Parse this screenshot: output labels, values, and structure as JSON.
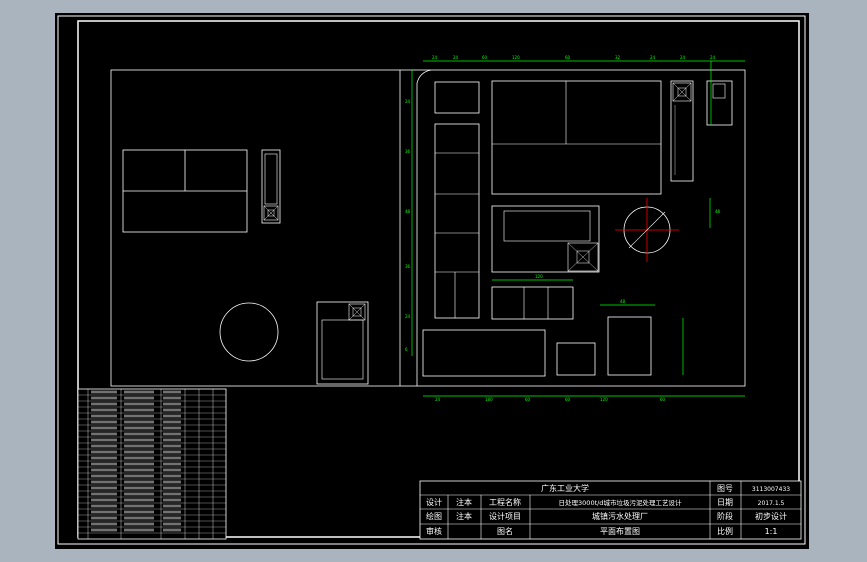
{
  "drawing": {
    "background": "#000000",
    "viewport_color": "#aab4be",
    "line_color": "#ffffff",
    "dimension_color": "#00ff00",
    "marker_color": "#ff0000"
  },
  "title_block": {
    "university": "广东工业大学",
    "drawing_no_label": "图号",
    "drawing_no": "3113007433",
    "design_label": "设计",
    "design_name": "注本",
    "project_name_label": "工程名称",
    "project_name": "日处理3000t/d城市垃圾污泥处理工艺设计",
    "date_label": "日期",
    "date": "2017.1.5",
    "drawing_label": "绘图",
    "drawing_name": "注本",
    "design_item_label": "设计项目",
    "design_item": "城镇污水处理厂",
    "stage_label": "阶段",
    "stage": "初步设计",
    "review_label": "审核",
    "drawing_title_label": "图名",
    "drawing_title": "平面布置图",
    "scale_label": "比例",
    "scale": "1:1"
  }
}
